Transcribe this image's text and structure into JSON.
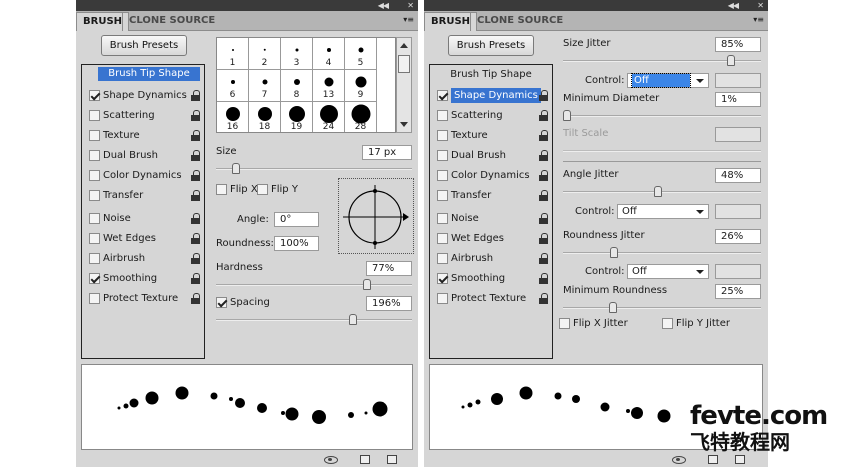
{
  "left_panel": {
    "tabs": [
      "BRUSH",
      "CLONE SOURCE"
    ],
    "presets_button": "Brush Presets",
    "options": [
      {
        "label": "Brush Tip Shape",
        "checked": null,
        "selected": true
      },
      {
        "label": "Shape Dynamics",
        "checked": true,
        "selected": false
      },
      {
        "label": "Scattering",
        "checked": false,
        "selected": false
      },
      {
        "label": "Texture",
        "checked": false,
        "selected": false
      },
      {
        "label": "Dual Brush",
        "checked": false,
        "selected": false
      },
      {
        "label": "Color Dynamics",
        "checked": false,
        "selected": false
      },
      {
        "label": "Transfer",
        "checked": false,
        "selected": false
      },
      {
        "label": "Noise",
        "checked": false,
        "selected": false
      },
      {
        "label": "Wet Edges",
        "checked": false,
        "selected": false
      },
      {
        "label": "Airbrush",
        "checked": false,
        "selected": false
      },
      {
        "label": "Smoothing",
        "checked": true,
        "selected": false
      },
      {
        "label": "Protect Texture",
        "checked": false,
        "selected": false
      }
    ],
    "brush_grid": [
      "1",
      "2",
      "3",
      "4",
      "5",
      "6",
      "7",
      "8",
      "13",
      "9",
      "16",
      "18",
      "19",
      "24",
      "28"
    ],
    "size_label": "Size",
    "size_value": "17 px",
    "size_slider": 0.1,
    "flip_x": "Flip X",
    "flip_y": "Flip Y",
    "angle_label": "Angle:",
    "angle_value": "0°",
    "roundness_label": "Roundness:",
    "roundness_value": "100%",
    "hardness_label": "Hardness",
    "hardness_value": "77%",
    "hardness_slider": 0.77,
    "spacing_label": "Spacing",
    "spacing_checked": true,
    "spacing_value": "196%",
    "spacing_slider": 0.7
  },
  "right_panel": {
    "tabs": [
      "BRUSH",
      "CLONE SOURCE"
    ],
    "presets_button": "Brush Presets",
    "options": [
      {
        "label": "Brush Tip Shape",
        "checked": null,
        "selected": false
      },
      {
        "label": "Shape Dynamics",
        "checked": true,
        "selected": true
      },
      {
        "label": "Scattering",
        "checked": false,
        "selected": false
      },
      {
        "label": "Texture",
        "checked": false,
        "selected": false
      },
      {
        "label": "Dual Brush",
        "checked": false,
        "selected": false
      },
      {
        "label": "Color Dynamics",
        "checked": false,
        "selected": false
      },
      {
        "label": "Transfer",
        "checked": false,
        "selected": false
      },
      {
        "label": "Noise",
        "checked": false,
        "selected": false
      },
      {
        "label": "Wet Edges",
        "checked": false,
        "selected": false
      },
      {
        "label": "Airbrush",
        "checked": false,
        "selected": false
      },
      {
        "label": "Smoothing",
        "checked": true,
        "selected": false
      },
      {
        "label": "Protect Texture",
        "checked": false,
        "selected": false
      }
    ],
    "size_jitter_label": "Size Jitter",
    "size_jitter_value": "85%",
    "size_jitter_slider": 0.85,
    "control_label": "Control:",
    "control1_value": "Off",
    "min_diameter_label": "Minimum Diameter",
    "min_diameter_value": "1%",
    "min_diameter_slider": 0.01,
    "tilt_scale_label": "Tilt Scale",
    "angle_jitter_label": "Angle Jitter",
    "angle_jitter_value": "48%",
    "angle_jitter_slider": 0.48,
    "control2_value": "Off",
    "roundness_jitter_label": "Roundness Jitter",
    "roundness_jitter_value": "26%",
    "roundness_jitter_slider": 0.26,
    "control3_value": "Off",
    "min_roundness_label": "Minimum Roundness",
    "min_roundness_value": "25%",
    "min_roundness_slider": 0.25,
    "flip_x_jitter": "Flip X Jitter",
    "flip_y_jitter": "Flip Y Jitter"
  },
  "watermark": {
    "en": "fevte.com",
    "cn": "飞特教程网"
  },
  "colors": {
    "panel": "#d6d6d6",
    "selection": "#3874d0",
    "tabbar": "#b4b4b4",
    "topbar": "#3a3a3a"
  }
}
